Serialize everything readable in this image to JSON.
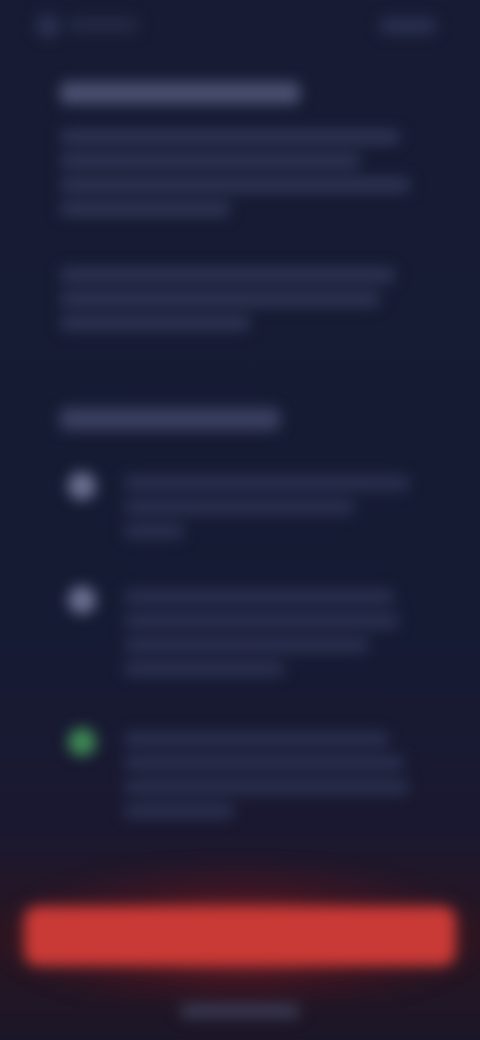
{
  "colors": {
    "background": "#161b34",
    "accent_button": "#c93a36",
    "success_step": "#3f8a55"
  },
  "icons": {
    "back": "back-arrow-icon",
    "step_one": "step-bullet-icon",
    "step_two": "step-bullet-icon",
    "step_three": "check-circle-icon"
  },
  "note": ""
}
